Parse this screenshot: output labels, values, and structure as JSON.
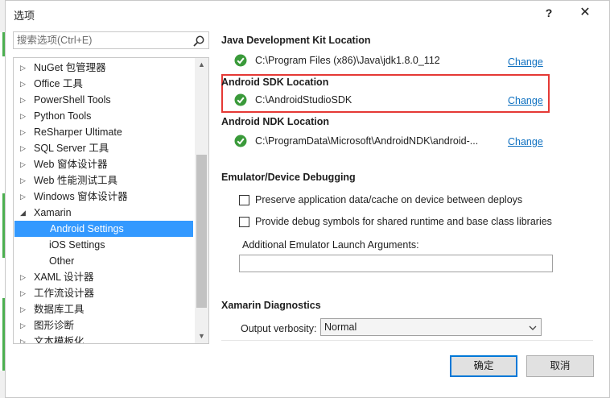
{
  "window": {
    "title": "选项",
    "help": "?",
    "close": "✕"
  },
  "search": {
    "placeholder": "搜索选项(Ctrl+E)"
  },
  "tree": {
    "items": [
      {
        "label": "NuGet 包管理器",
        "arrow": "▷"
      },
      {
        "label": "Office 工具",
        "arrow": "▷"
      },
      {
        "label": "PowerShell Tools",
        "arrow": "▷"
      },
      {
        "label": "Python Tools",
        "arrow": "▷"
      },
      {
        "label": "ReSharper Ultimate",
        "arrow": "▷"
      },
      {
        "label": "SQL Server 工具",
        "arrow": "▷"
      },
      {
        "label": "Web 窗体设计器",
        "arrow": "▷"
      },
      {
        "label": "Web 性能测试工具",
        "arrow": "▷"
      },
      {
        "label": "Windows 窗体设计器",
        "arrow": "▷"
      },
      {
        "label": "Xamarin",
        "arrow": "◢"
      },
      {
        "label": "Android Settings",
        "arrow": ""
      },
      {
        "label": "iOS Settings",
        "arrow": ""
      },
      {
        "label": "Other",
        "arrow": ""
      },
      {
        "label": "XAML 设计器",
        "arrow": "▷"
      },
      {
        "label": "工作流设计器",
        "arrow": "▷"
      },
      {
        "label": "数据库工具",
        "arrow": "▷"
      },
      {
        "label": "图形诊断",
        "arrow": "▷"
      },
      {
        "label": "文本模板化",
        "arrow": "▷"
      }
    ],
    "selected_index": 10,
    "scroll_up": "▲",
    "scroll_down": "▼"
  },
  "content": {
    "jdk": {
      "title": "Java Development Kit Location",
      "path": "C:\\Program Files (x86)\\Java\\jdk1.8.0_112",
      "change": "Change"
    },
    "sdk": {
      "title": "Android SDK Location",
      "path": "C:\\AndroidStudioSDK",
      "change": "Change"
    },
    "ndk": {
      "title": "Android NDK Location",
      "path": "C:\\ProgramData\\Microsoft\\AndroidNDK\\android-...",
      "change": "Change"
    },
    "emulator": {
      "title": "Emulator/Device Debugging",
      "preserve": "Preserve application data/cache on device between deploys",
      "debug_symbols": "Provide debug symbols for shared runtime and base class libraries",
      "args_label": "Additional Emulator Launch Arguments:",
      "args_value": ""
    },
    "diagnostics": {
      "title": "Xamarin Diagnostics",
      "verbosity_label": "Output verbosity:",
      "verbosity_value": "Normal"
    }
  },
  "buttons": {
    "ok": "确定",
    "cancel": "取消"
  },
  "colors": {
    "accent": "#3399ff",
    "check": "#3a9a3a",
    "highlight": "#e53935",
    "link": "#0e70c0"
  }
}
